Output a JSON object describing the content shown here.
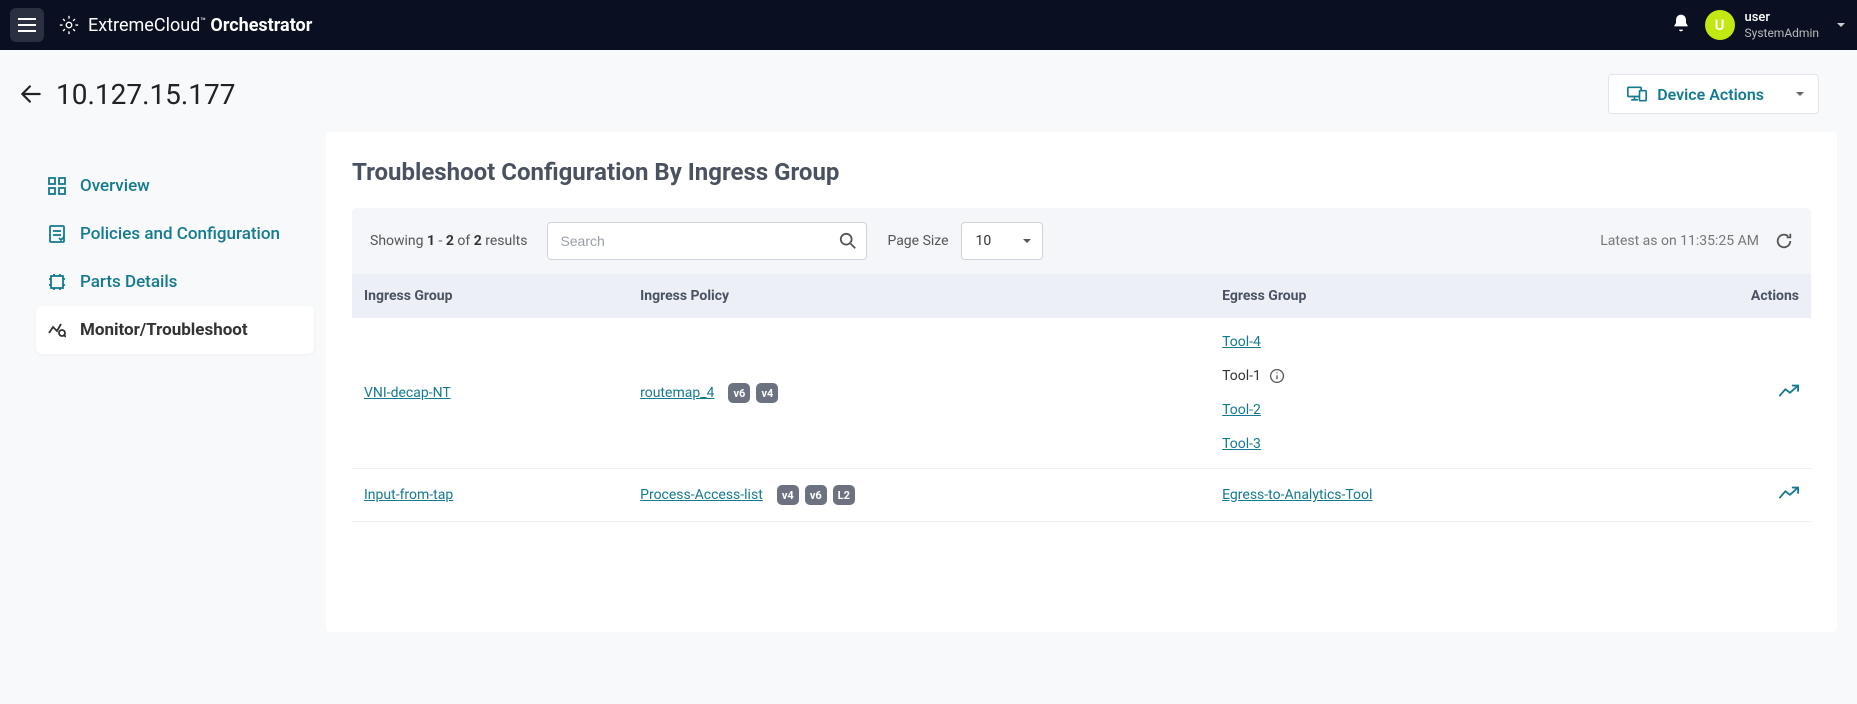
{
  "brand": {
    "part1": "ExtremeCloud",
    "tm": "™",
    "part2": "Orchestrator"
  },
  "user": {
    "initial": "U",
    "name": "user",
    "role": "SystemAdmin"
  },
  "page": {
    "ip": "10.127.15.177",
    "device_actions": "Device Actions"
  },
  "sidebar": {
    "items": [
      {
        "label": "Overview"
      },
      {
        "label": "Policies and Configuration"
      },
      {
        "label": "Parts Details"
      },
      {
        "label": "Monitor/Troubleshoot"
      }
    ]
  },
  "content": {
    "title": "Troubleshoot Configuration By Ingress Group",
    "showing_prefix": "Showing ",
    "from": "1",
    "dash": " - ",
    "to": "2",
    "of_word": " of ",
    "total": "2",
    "results_word": " results",
    "search_placeholder": "Search",
    "page_size_label": "Page Size",
    "page_size_value": "10",
    "latest_text": "Latest as on 11:35:25 AM"
  },
  "table": {
    "headers": {
      "c1": "Ingress Group",
      "c2": "Ingress Policy",
      "c3": "Egress Group",
      "c4": "Actions"
    },
    "rows": [
      {
        "ingress_group": "VNI-decap-NT",
        "ingress_policy": "routemap_4",
        "badges": [
          "v6",
          "v4"
        ],
        "egress": [
          {
            "label": "Tool-4",
            "link": true,
            "info": false
          },
          {
            "label": "Tool-1",
            "link": false,
            "info": true
          },
          {
            "label": "Tool-2",
            "link": true,
            "info": false
          },
          {
            "label": "Tool-3",
            "link": true,
            "info": false
          }
        ]
      },
      {
        "ingress_group": "Input-from-tap",
        "ingress_policy": "Process-Access-list",
        "badges": [
          "v4",
          "v6",
          "L2"
        ],
        "egress": [
          {
            "label": "Egress-to-Analytics-Tool",
            "link": true,
            "info": false
          }
        ]
      }
    ]
  }
}
